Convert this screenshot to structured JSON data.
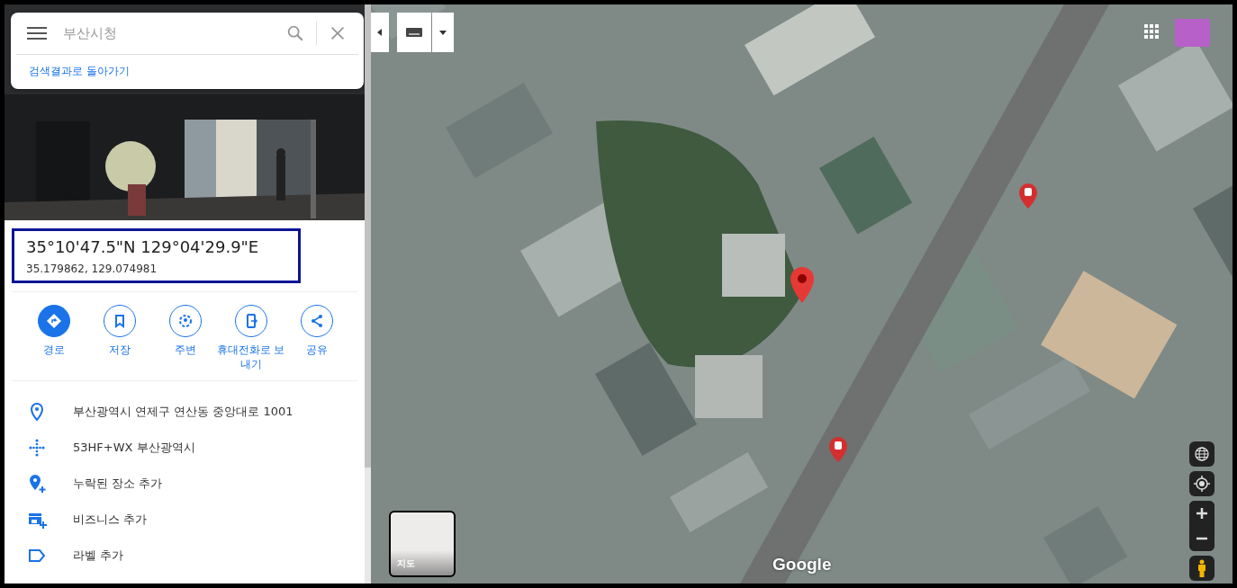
{
  "search": {
    "placeholder": "부산시청",
    "back_link": "검색결과로 돌아가기"
  },
  "coordinates": {
    "dms": "35°10'47.5\"N 129°04'29.9\"E",
    "decimal": "35.179862, 129.074981"
  },
  "actions": [
    {
      "kind": "directions",
      "label": "경로",
      "primary": true
    },
    {
      "kind": "save",
      "label": "저장",
      "primary": false
    },
    {
      "kind": "nearby",
      "label": "주변",
      "primary": false
    },
    {
      "kind": "phone",
      "label": "휴대전화로 보내기",
      "primary": false
    },
    {
      "kind": "share",
      "label": "공유",
      "primary": false
    }
  ],
  "details": [
    {
      "kind": "address",
      "text": "부산광역시 연제구 연산동 중앙대로 1001"
    },
    {
      "kind": "pluscode",
      "text": "53HF+WX 부산광역시"
    },
    {
      "kind": "addplace",
      "text": "누락된 장소 추가"
    },
    {
      "kind": "business",
      "text": "비즈니스 추가"
    },
    {
      "kind": "label",
      "text": "라벨 추가"
    }
  ],
  "map": {
    "layer_toggle": "지도",
    "logo": "Google"
  }
}
